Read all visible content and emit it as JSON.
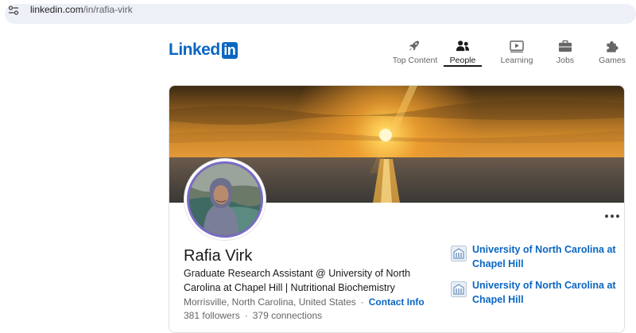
{
  "browser": {
    "url_host": "linkedin.com",
    "url_path": "/in/rafia-virk"
  },
  "header": {
    "logo_text": "Linked",
    "logo_box": "in",
    "nav": [
      {
        "label": "Top Content",
        "icon": "rocket-icon",
        "active": false
      },
      {
        "label": "People",
        "icon": "people-icon",
        "active": true
      },
      {
        "label": "Learning",
        "icon": "play-icon",
        "active": false
      },
      {
        "label": "Jobs",
        "icon": "briefcase-icon",
        "active": false
      },
      {
        "label": "Games",
        "icon": "puzzle-icon",
        "active": false
      }
    ]
  },
  "profile": {
    "name": "Rafia Virk",
    "headline": "Graduate Research Assistant @ University of North Carolina at Chapel Hill | Nutritional Biochemistry",
    "location": "Morrisville, North Carolina, United States",
    "separator": "·",
    "contact_info": "Contact Info",
    "followers": "381 followers",
    "connections": "379 connections",
    "more_icon": "more-options-icon"
  },
  "education": [
    {
      "name": "University of North Carolina at Chapel Hill",
      "icon": "university-seal-icon"
    },
    {
      "name": "University of North Carolina at Chapel Hill",
      "icon": "university-seal-icon"
    }
  ],
  "colors": {
    "brand": "#0a66c2",
    "text": "#191919",
    "muted": "#666666"
  }
}
